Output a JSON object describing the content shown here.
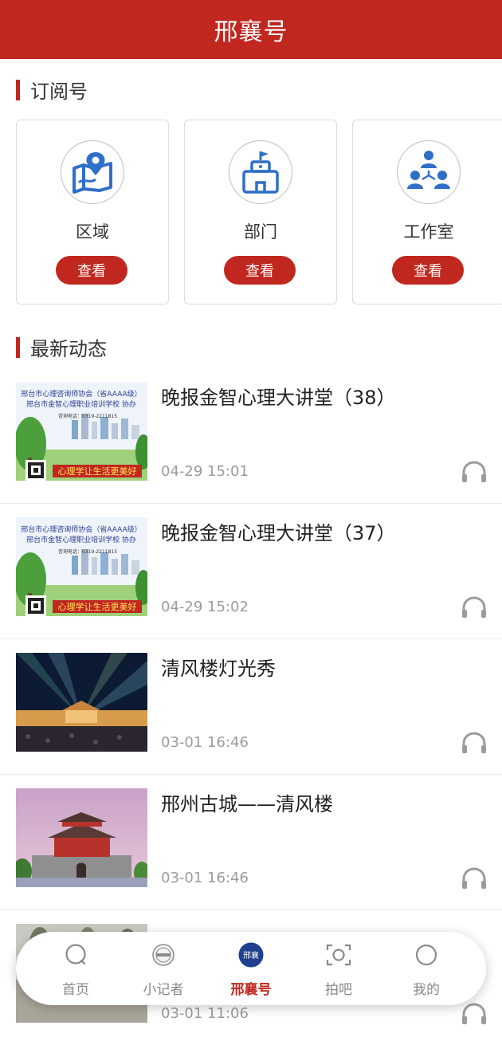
{
  "header": {
    "title": "邢襄号"
  },
  "subscription": {
    "title": "订阅号",
    "cards": [
      {
        "icon": "map-location-icon",
        "label": "区域",
        "button": "查看"
      },
      {
        "icon": "building-flag-icon",
        "label": "部门",
        "button": "查看"
      },
      {
        "icon": "team-icon",
        "label": "工作室",
        "button": "查看"
      }
    ]
  },
  "news": {
    "title": "最新动态",
    "items": [
      {
        "title": "晚报金智心理大讲堂（38）",
        "time": "04-29 15:01",
        "thumb": {
          "line1": "邢台市心理咨询师协会（省AAAA级）",
          "line2": "邢台市金智心理职业培训学校 协办",
          "phone": "咨询电话：0319-2211815",
          "slogan": "心理学让生活更美好"
        }
      },
      {
        "title": "晚报金智心理大讲堂（37）",
        "time": "04-29 15:02",
        "thumb": {
          "line1": "邢台市心理咨询师协会（省AAAA级）",
          "line2": "邢台市金智心理职业培训学校 协办",
          "phone": "咨询电话：0319-2211815",
          "slogan": "心理学让生活更美好"
        }
      },
      {
        "title": "清风楼灯光秀",
        "time": "03-01 16:46"
      },
      {
        "title": "邢州古城——清风楼",
        "time": "03-01 16:46"
      },
      {
        "title": "",
        "time": "03-01 11:06"
      }
    ]
  },
  "tabbar": {
    "items": [
      {
        "label": "首页",
        "icon": "home-icon"
      },
      {
        "label": "小记者",
        "icon": "reporter-badge-icon"
      },
      {
        "label": "邢襄号",
        "icon": "xingxiang-logo-icon",
        "badge": "邢襄"
      },
      {
        "label": "拍吧",
        "icon": "camera-scan-icon"
      },
      {
        "label": "我的",
        "icon": "profile-icon"
      }
    ]
  },
  "colors": {
    "brand": "#c0271f",
    "icon_blue": "#2f6fc9",
    "muted": "#9b9b9b"
  }
}
